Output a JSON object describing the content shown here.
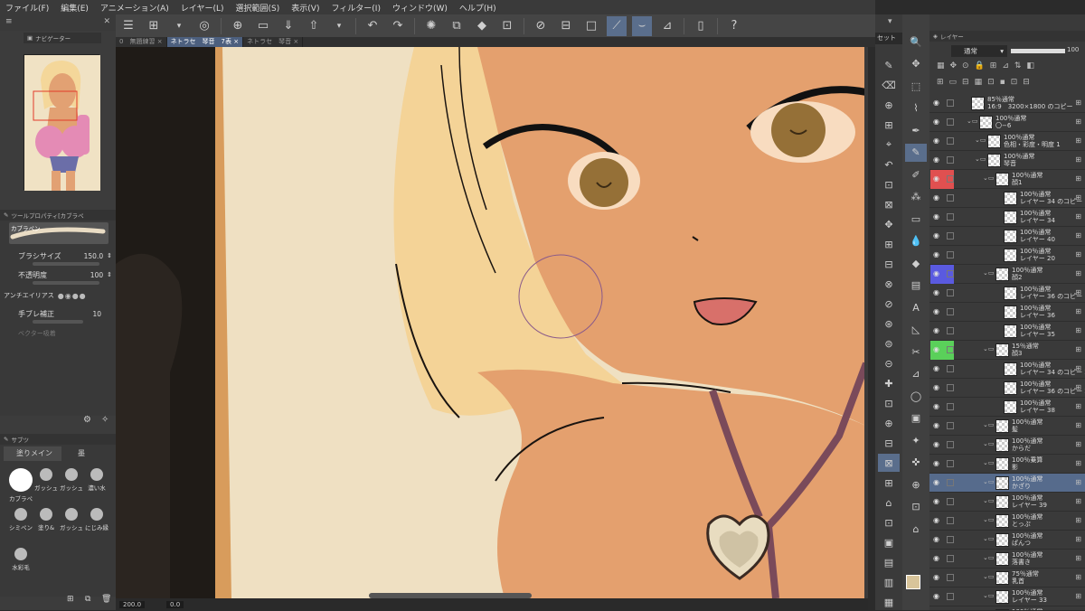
{
  "menu": [
    "ファイル(F)",
    "編集(E)",
    "アニメーション(A)",
    "レイヤー(L)",
    "選択範囲(S)",
    "表示(V)",
    "フィルター(I)",
    "ウィンドウ(W)",
    "ヘルプ(H)"
  ],
  "tabs": [
    {
      "label": "0　無題練習",
      "active": false
    },
    {
      "label": "ネトラセ　琴音　7表",
      "active": true
    },
    {
      "label": "ネトラセ　琴音",
      "active": false
    }
  ],
  "left": {
    "navigator_title": "ナビゲーター",
    "toolprop_title": "ツールプロパティ[カブラペ",
    "brush_name": "カブラペン",
    "brush_size_label": "ブラシサイズ",
    "brush_size_value": "150.0",
    "opacity_label": "不透明度",
    "opacity_value": "100",
    "antialias_label": "アンチエイリアス",
    "stabilization_label": "手ブレ補正",
    "stabilization_value": "10",
    "vector_label": "ベクター吸着",
    "subtool_title": "サブツ",
    "subtool_tabs": [
      "塗りメイン",
      "墨"
    ],
    "brushes": [
      "カブラペ",
      "ガッシュ",
      "ガッシュ",
      "濃い水",
      "シミペン",
      "塗り&",
      "ガッシュ",
      "にじみ縁",
      "水彩毛"
    ]
  },
  "status": {
    "zoom": "200.0",
    "rotation": "0.0"
  },
  "layers": {
    "title": "レイヤー",
    "blend_mode": "通常",
    "opacity": "100",
    "set_label": "セット",
    "rows": [
      {
        "line1": "85％通常",
        "line2": "16:9　3200×1800 のコピー",
        "indent": 0,
        "mark": ""
      },
      {
        "line1": "100％通常",
        "line2": "〇−6",
        "indent": 1,
        "mark": ""
      },
      {
        "line1": "100％通常",
        "line2": "色相・彩度・明度 1",
        "indent": 2,
        "mark": ""
      },
      {
        "line1": "100％通常",
        "line2": "琴音",
        "indent": 2,
        "mark": ""
      },
      {
        "line1": "100％通常",
        "line2": "顔1",
        "indent": 3,
        "mark": "red"
      },
      {
        "line1": "100％通常",
        "line2": "レイヤー 34 のコピー",
        "indent": 4,
        "mark": ""
      },
      {
        "line1": "100％通常",
        "line2": "レイヤー 34",
        "indent": 4,
        "mark": ""
      },
      {
        "line1": "100％通常",
        "line2": "レイヤー 40",
        "indent": 4,
        "mark": ""
      },
      {
        "line1": "100％通常",
        "line2": "レイヤー 20",
        "indent": 4,
        "mark": ""
      },
      {
        "line1": "100％通常",
        "line2": "顔2",
        "indent": 3,
        "mark": "blue"
      },
      {
        "line1": "100％通常",
        "line2": "レイヤー 36 のコピー",
        "indent": 4,
        "mark": ""
      },
      {
        "line1": "100％通常",
        "line2": "レイヤー 36",
        "indent": 4,
        "mark": ""
      },
      {
        "line1": "100％通常",
        "line2": "レイヤー 35",
        "indent": 4,
        "mark": ""
      },
      {
        "line1": "15％通常",
        "line2": "顔3",
        "indent": 3,
        "mark": "green"
      },
      {
        "line1": "100％通常",
        "line2": "レイヤー 34 のコピー 2",
        "indent": 4,
        "mark": ""
      },
      {
        "line1": "100％通常",
        "line2": "レイヤー 36 のコピー 2",
        "indent": 4,
        "mark": ""
      },
      {
        "line1": "100％通常",
        "line2": "レイヤー 38",
        "indent": 4,
        "mark": ""
      },
      {
        "line1": "100％通常",
        "line2": "髪",
        "indent": 3,
        "mark": ""
      },
      {
        "line1": "100％通常",
        "line2": "からだ",
        "indent": 3,
        "mark": ""
      },
      {
        "line1": "100％乗算",
        "line2": "影",
        "indent": 3,
        "mark": ""
      },
      {
        "line1": "100％通常",
        "line2": "かざり",
        "indent": 3,
        "mark": "",
        "selected": true
      },
      {
        "line1": "100％通常",
        "line2": "レイヤー 39",
        "indent": 3,
        "mark": ""
      },
      {
        "line1": "100％通常",
        "line2": "とっぷ",
        "indent": 3,
        "mark": ""
      },
      {
        "line1": "100％通常",
        "line2": "ぱんつ",
        "indent": 3,
        "mark": ""
      },
      {
        "line1": "100％通常",
        "line2": "落書き",
        "indent": 3,
        "mark": ""
      },
      {
        "line1": "75％通常",
        "line2": "乳首",
        "indent": 3,
        "mark": ""
      },
      {
        "line1": "100％通常",
        "line2": "レイヤー 33",
        "indent": 3,
        "mark": ""
      },
      {
        "line1": "100％通常",
        "line2": "",
        "indent": 3,
        "mark": ""
      }
    ]
  },
  "colors": {
    "accent": "#566b8c",
    "skin": "#e6a06e",
    "hair": "#f2cf8c",
    "bg": "#efe0c0"
  }
}
